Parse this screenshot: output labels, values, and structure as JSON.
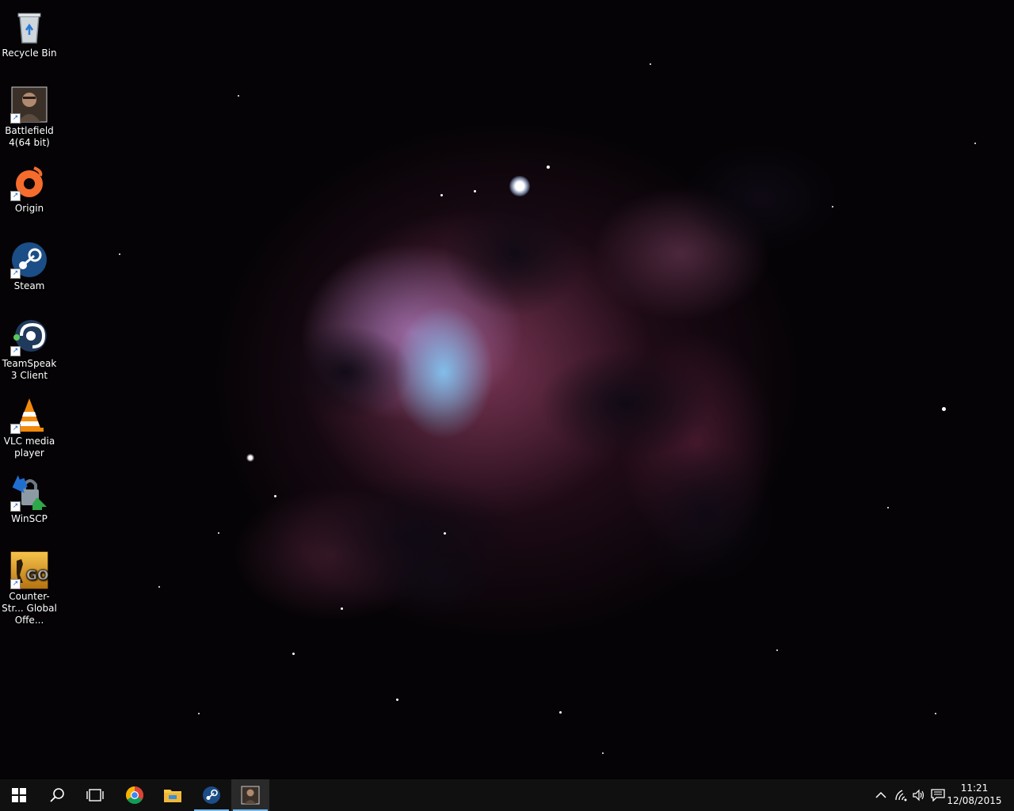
{
  "desktop": {
    "icons": [
      {
        "label": "Recycle Bin",
        "icon": "recycle-bin-icon"
      },
      {
        "label": "Battlefield 4(64 bit)",
        "icon": "battlefield-icon"
      },
      {
        "label": "Origin",
        "icon": "origin-icon"
      },
      {
        "label": "Steam",
        "icon": "steam-icon"
      },
      {
        "label": "TeamSpeak 3 Client",
        "icon": "teamspeak-icon"
      },
      {
        "label": "VLC media player",
        "icon": "vlc-icon"
      },
      {
        "label": "WinSCP",
        "icon": "winscp-icon"
      },
      {
        "label": "Counter-Str... Global Offe...",
        "icon": "csgo-icon"
      }
    ],
    "csgo_logo_text": "GO"
  },
  "taskbar": {
    "buttons": [
      "start-icon",
      "search-icon",
      "task-view-icon",
      "chrome-icon",
      "file-explorer-icon",
      "steam-icon",
      "battlefield-icon"
    ],
    "active_colors": {
      "accent": "#76b9ed",
      "taskbar": "#101010"
    },
    "tray": [
      "chevron-up-icon",
      "network-icon",
      "volume-icon",
      "action-center-icon"
    ],
    "clock": {
      "time": "11:21",
      "date": "12/08/2015"
    }
  }
}
